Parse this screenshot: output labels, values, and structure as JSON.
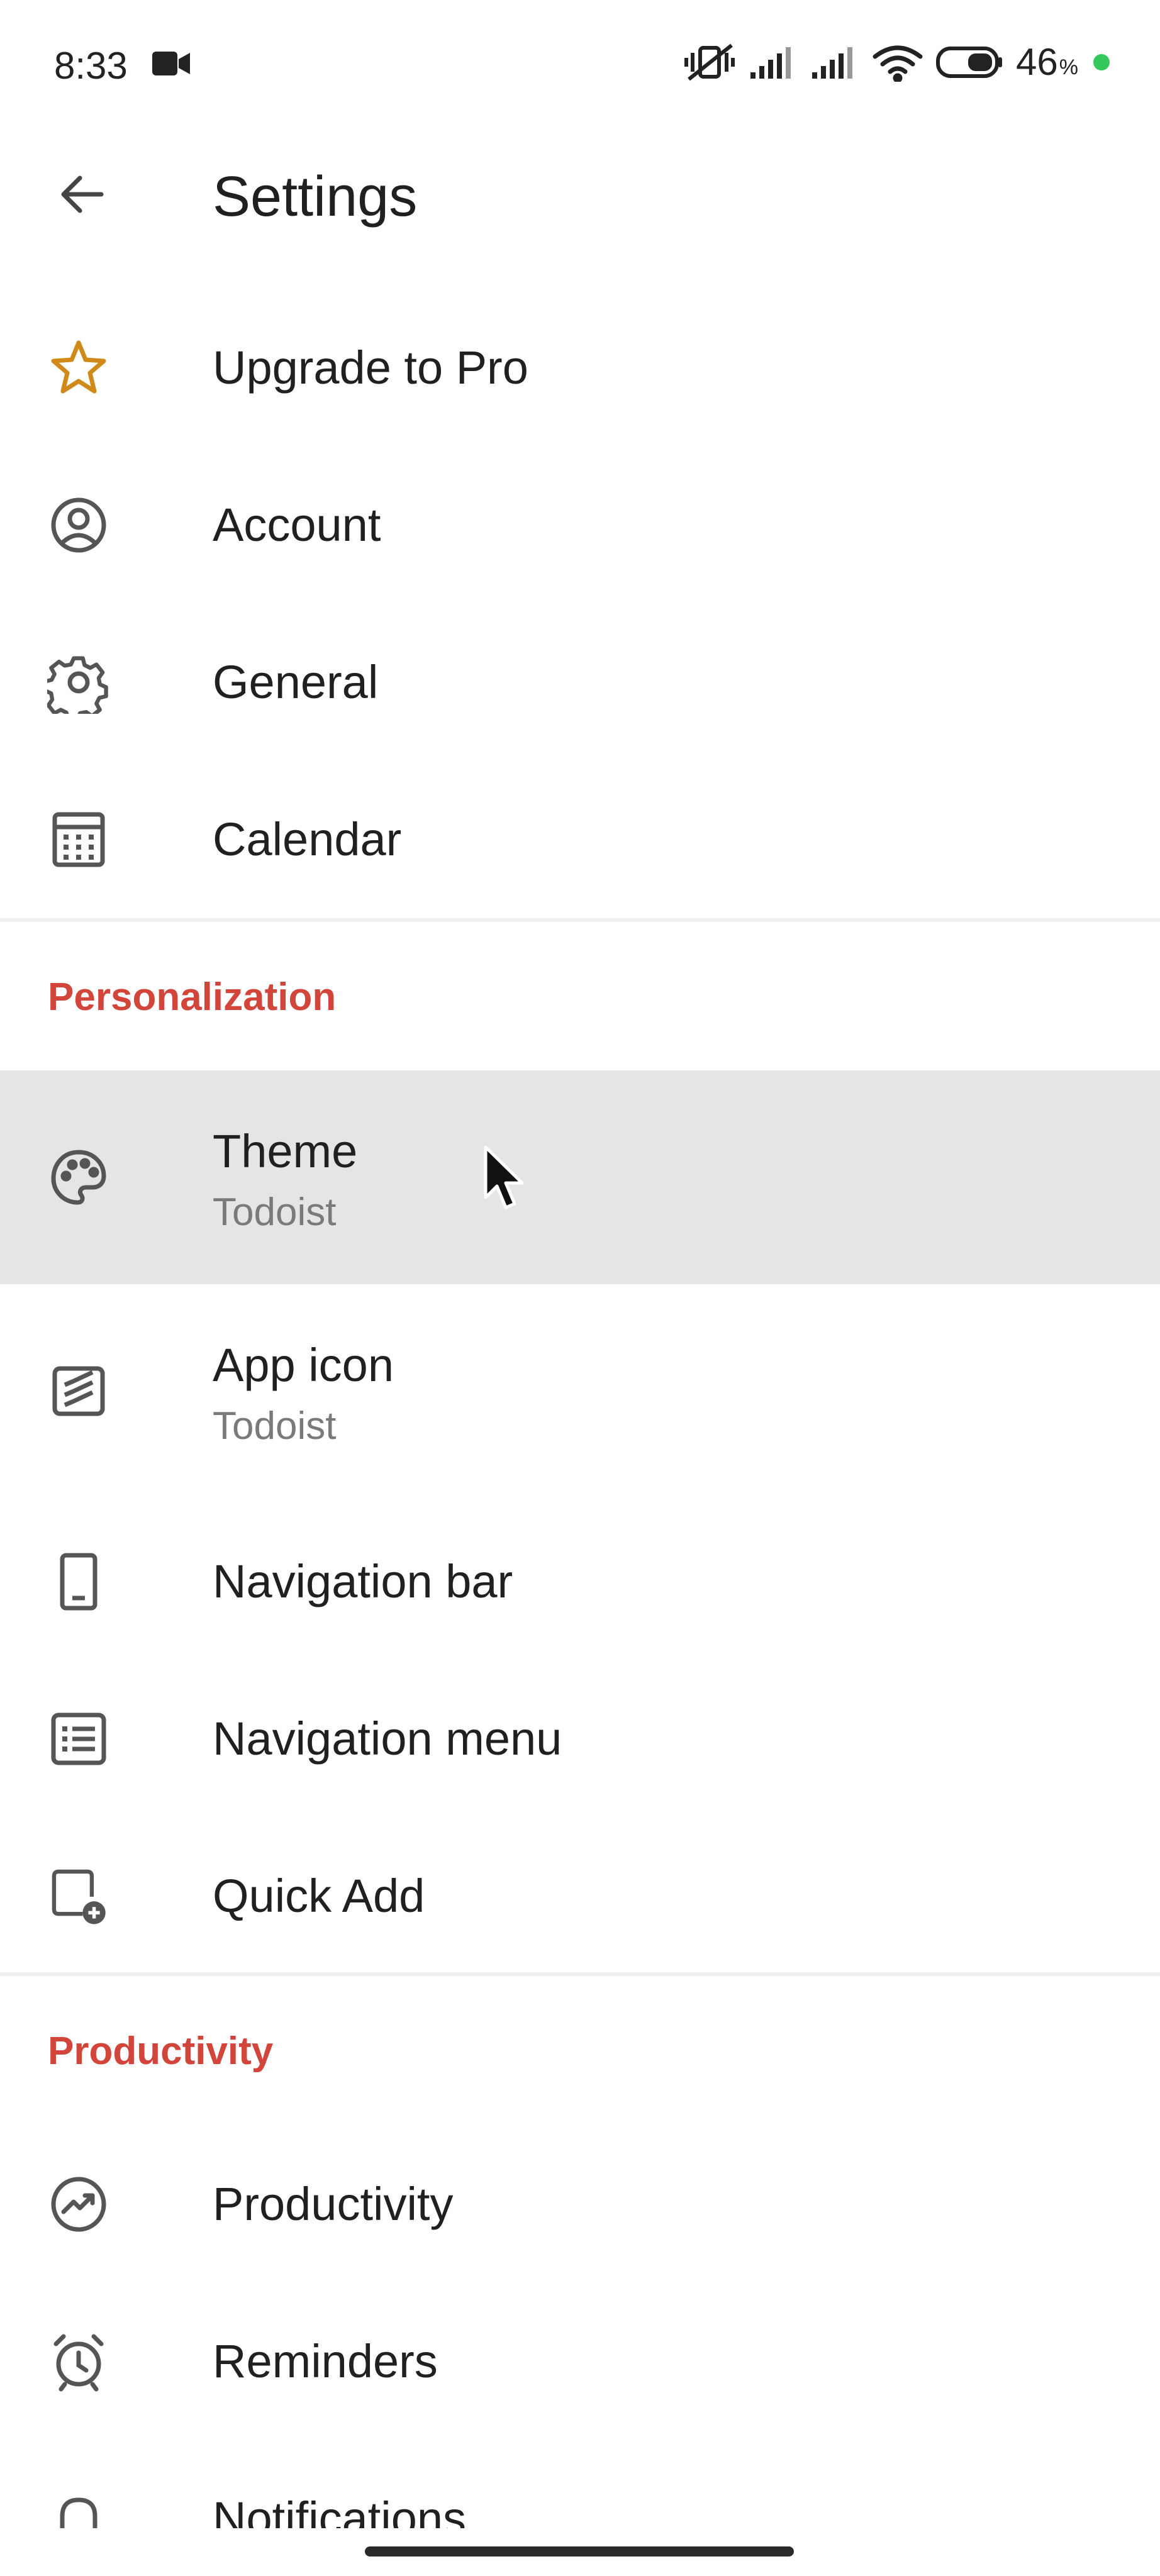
{
  "status_bar": {
    "time": "8:33",
    "battery": "46",
    "battery_unit": "%"
  },
  "app_bar": {
    "title": "Settings"
  },
  "items": {
    "upgrade": {
      "label": "Upgrade to Pro"
    },
    "account": {
      "label": "Account"
    },
    "general": {
      "label": "General"
    },
    "calendar": {
      "label": "Calendar"
    },
    "theme": {
      "label": "Theme",
      "value": "Todoist"
    },
    "app_icon": {
      "label": "App icon",
      "value": "Todoist"
    },
    "navigation_bar": {
      "label": "Navigation bar"
    },
    "navigation_menu": {
      "label": "Navigation menu"
    },
    "quick_add": {
      "label": "Quick Add"
    },
    "productivity": {
      "label": "Productivity"
    },
    "reminders": {
      "label": "Reminders"
    },
    "notifications": {
      "label": "Notifications"
    }
  },
  "sections": {
    "personalization": "Personalization",
    "productivity": "Productivity"
  },
  "colors": {
    "accent": "#d1453b",
    "star": "#d08a1a",
    "selected_row": "#e5e5e5"
  }
}
